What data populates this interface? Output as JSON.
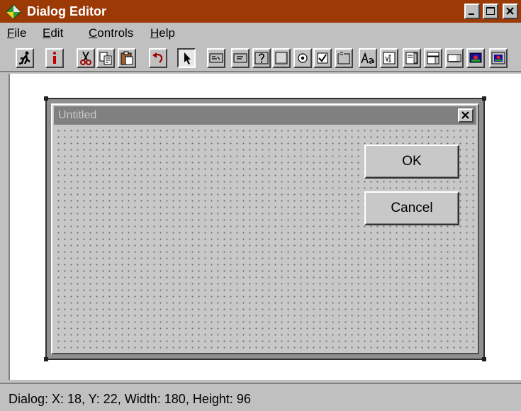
{
  "window": {
    "title": "Dialog Editor",
    "app_icon": "diamond-app-icon",
    "controls": [
      "minimize-icon",
      "maximize-icon",
      "close-icon"
    ],
    "title_color": "#9c3a06"
  },
  "menu": {
    "items": [
      {
        "label": "File",
        "mnemonic": "F",
        "rest": "ile"
      },
      {
        "label": "Edit",
        "mnemonic": "E",
        "rest": "dit"
      },
      {
        "label": "Controls",
        "mnemonic": "C",
        "rest": "ontrols"
      },
      {
        "label": "Help",
        "mnemonic": "H",
        "rest": "elp"
      }
    ]
  },
  "toolbar": {
    "tools": [
      "run-dialog-icon",
      "info-icon",
      "cut-icon",
      "copy-icon",
      "paste-icon",
      "undo-icon",
      "pointer-select-icon",
      "ok-button-tool-icon",
      "cancel-button-tool-icon",
      "help-button-tool-icon",
      "push-button-tool-icon",
      "option-button-tool-icon",
      "checkbox-tool-icon",
      "group-box-tool-icon",
      "text-tool-icon",
      "text-box-tool-icon",
      "list-box-tool-icon",
      "combo-box-tool-icon",
      "drop-list-tool-icon",
      "picture-tool-icon",
      "picture-button-tool-icon"
    ],
    "active_tool": "pointer-select-icon"
  },
  "dialog": {
    "title": "Untitled",
    "close_icon": "close-icon",
    "buttons": [
      {
        "label": "OK"
      },
      {
        "label": "Cancel"
      }
    ],
    "grid": true
  },
  "status": {
    "text": "Dialog: X: 18, Y: 22, Width: 180, Height: 96"
  }
}
